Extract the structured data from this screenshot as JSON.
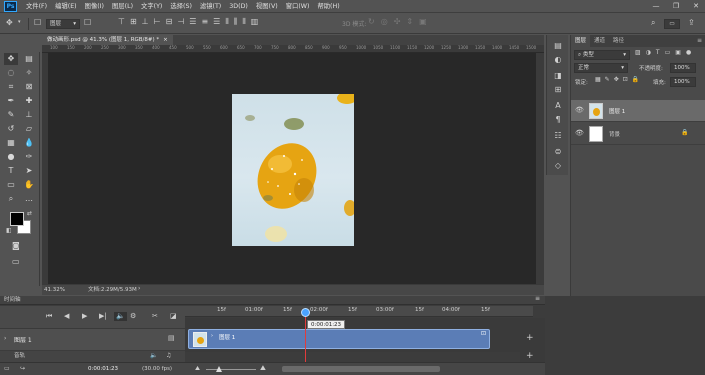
{
  "app": {
    "logo": "Ps"
  },
  "menu": [
    "文件(F)",
    "编辑(E)",
    "图像(I)",
    "图层(L)",
    "文字(Y)",
    "选择(S)",
    "滤镜(T)",
    "3D(D)",
    "视图(V)",
    "窗口(W)",
    "帮助(H)"
  ],
  "window_controls": {
    "minimize": "—",
    "restore": "❐",
    "close": "✕"
  },
  "options_bar": {
    "layer_select": "图层",
    "mode_3d_label": "3D 模式:"
  },
  "document": {
    "tab_title": "做动画形.psd @ 41.3% (图层 1, RGB/8#) *",
    "ruler_marks": [
      "100",
      "150",
      "200",
      "250",
      "300",
      "350",
      "400",
      "450",
      "500",
      "550",
      "600",
      "650",
      "700",
      "750",
      "800",
      "850",
      "900",
      "950",
      "1000",
      "1050",
      "1100",
      "1150",
      "1200",
      "1250",
      "1300",
      "1350",
      "1400",
      "1450",
      "1500"
    ],
    "zoom": "41.32%",
    "doc_size": "文档:2.29M/5.93M"
  },
  "layers_panel": {
    "tabs": [
      "图层",
      "通道",
      "路径"
    ],
    "kind_filter": "类型",
    "blend_mode": "正常",
    "opacity_label": "不透明度:",
    "opacity_value": "100%",
    "lock_label": "锁定:",
    "fill_label": "填充:",
    "fill_value": "100%",
    "layers": [
      {
        "name": "图层 1",
        "selected": true,
        "visible": true
      },
      {
        "name": "背景",
        "selected": false,
        "visible": true,
        "locked": true
      }
    ]
  },
  "timeline": {
    "title": "时间轴",
    "ticks": [
      "15f",
      "01:00f",
      "15f",
      "02:00f",
      "15f",
      "03:00f",
      "15f",
      "04:00f",
      "15f"
    ],
    "playhead_time": "0:00:01:23",
    "track_name": "图层 1",
    "clip_label": "图层 1",
    "audio_label": "音轨",
    "current_time": "0:00:01:23",
    "fps": "(30.00 fps)"
  },
  "colors": {
    "accent": "#31a8ff",
    "clip": "#5b7db6",
    "playhead": "#e03c3c",
    "panel_bg": "#535353",
    "canvas_bg": "#282828"
  }
}
